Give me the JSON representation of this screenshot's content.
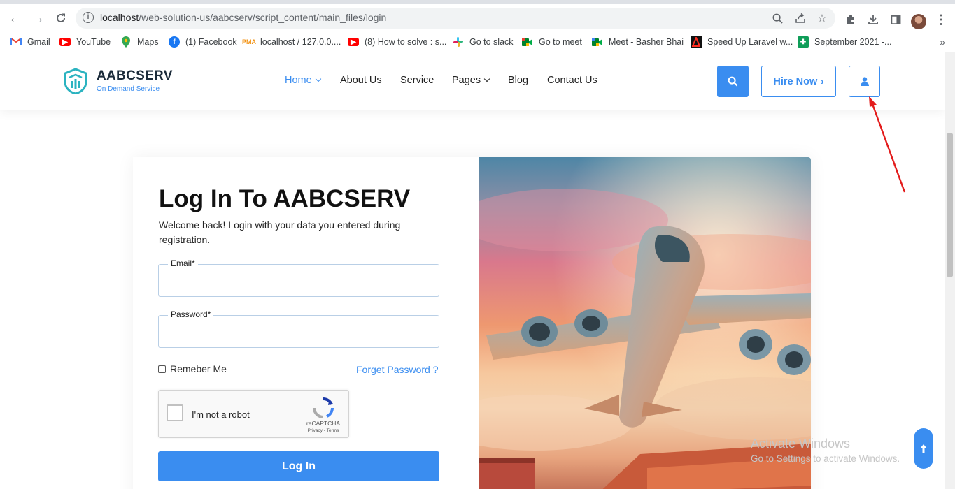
{
  "browser": {
    "url_host": "localhost",
    "url_path": "/web-solution-us/aabcserv/script_content/main_files/login"
  },
  "bookmarks": [
    {
      "label": "Gmail",
      "icon": "gmail-icon",
      "color": "#ea4335"
    },
    {
      "label": "YouTube",
      "icon": "youtube-icon",
      "color": "#ff0000"
    },
    {
      "label": "Maps",
      "icon": "maps-icon",
      "color": "#34a853"
    },
    {
      "label": "(1) Facebook",
      "icon": "facebook-icon",
      "color": "#1877f2"
    },
    {
      "label": "localhost / 127.0.0....",
      "icon": "phpmyadmin-icon",
      "color": "#f29111"
    },
    {
      "label": "(8) How to solve : s...",
      "icon": "youtube-icon",
      "color": "#ff0000"
    },
    {
      "label": "Go to slack",
      "icon": "slack-icon",
      "color": "#e01e5a"
    },
    {
      "label": "Go to meet",
      "icon": "meet-icon",
      "color": "#00832d"
    },
    {
      "label": "Meet - Basher Bhai",
      "icon": "meet-icon",
      "color": "#00832d"
    },
    {
      "label": "Speed Up Laravel w...",
      "icon": "laravel-icon",
      "color": "#111111"
    },
    {
      "label": "September 2021 -...",
      "icon": "sheets-icon",
      "color": "#0f9d58"
    }
  ],
  "site": {
    "brand": "AABCSERV",
    "tagline": "On Demand Service",
    "accent": "#3a8df0",
    "nav": {
      "home": "Home",
      "about": "About Us",
      "service": "Service",
      "pages": "Pages",
      "blog": "Blog",
      "contact": "Contact Us"
    },
    "hire_label": "Hire Now"
  },
  "login": {
    "title": "Log In To AABCSERV",
    "subtitle": "Welcome back! Login with your data you entered during registration.",
    "email_label": "Email*",
    "email_value": "",
    "password_label": "Password*",
    "password_value": "",
    "remember_label": "Remeber Me",
    "forgot_label": "Forget Password ?",
    "captcha_label": "I'm not a robot",
    "captcha_brand": "reCAPTCHA",
    "captcha_terms": "Privacy - Terms",
    "submit_label": "Log In"
  },
  "watermark": {
    "line1": "Activate Windows",
    "line2": "Go to Settings to activate Windows."
  }
}
